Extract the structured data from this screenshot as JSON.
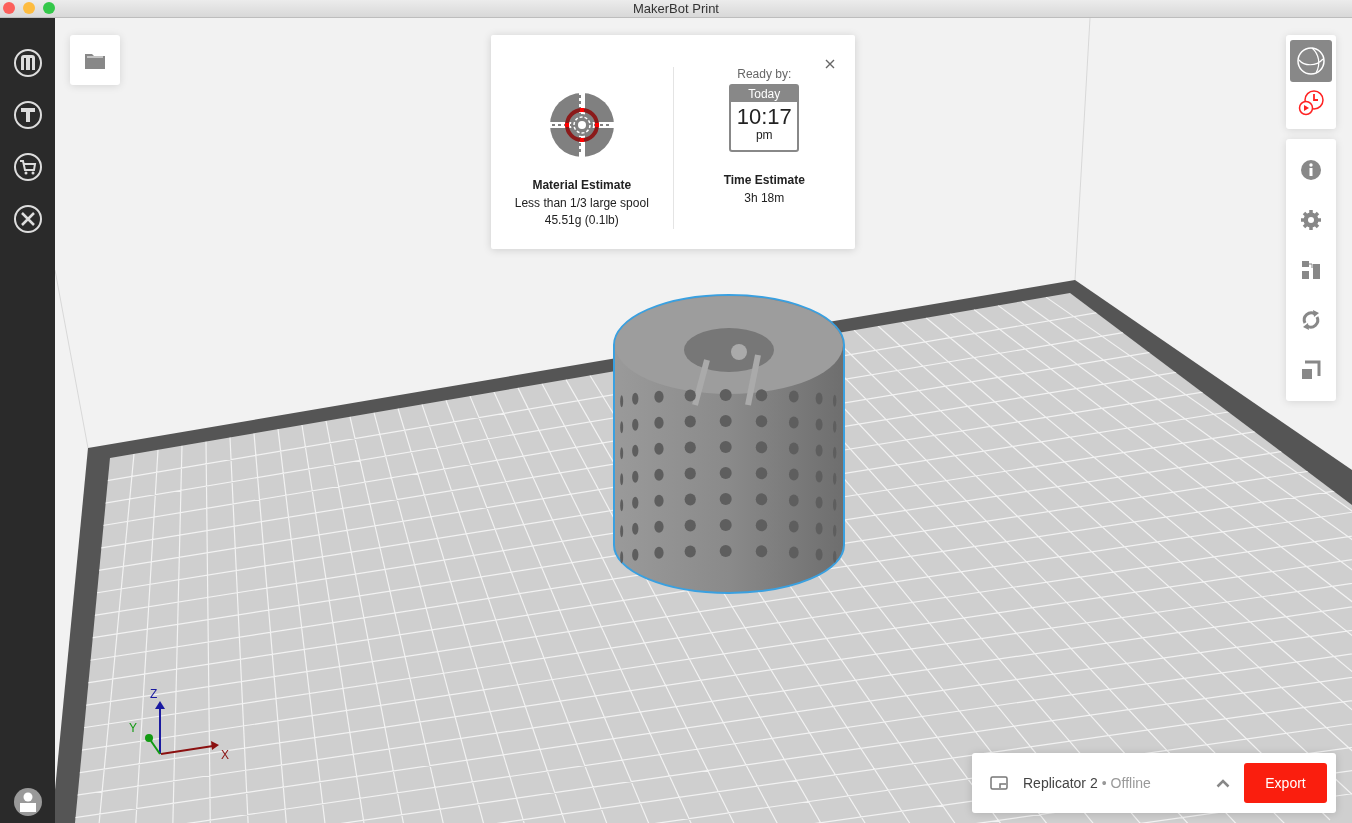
{
  "window": {
    "title": "MakerBot Print"
  },
  "estimate_panel": {
    "material": {
      "title": "Material Estimate",
      "detail": "Less than 1/3 large spool",
      "weight": "45.51g (0.1lb)"
    },
    "time": {
      "ready_label": "Ready by:",
      "day": "Today",
      "clock": "10:17",
      "meridiem": "pm",
      "title": "Time Estimate",
      "duration": "3h 18m"
    }
  },
  "view_modes": [
    {
      "kind": "model",
      "selected": true
    },
    {
      "kind": "preview",
      "selected": false
    }
  ],
  "axes": {
    "x": "X",
    "y": "Y",
    "z": "Z"
  },
  "printer": {
    "name": "Replicator 2",
    "separator": "•",
    "status": "Offline"
  },
  "export_button": "Export"
}
